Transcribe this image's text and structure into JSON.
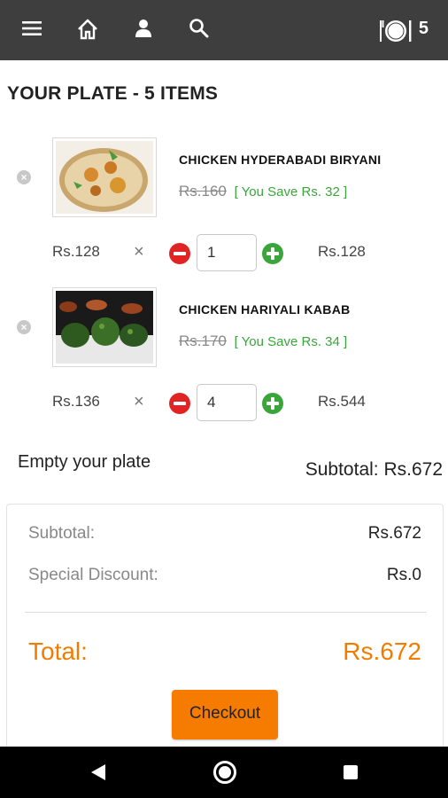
{
  "appbar": {
    "icons": [
      "menu-icon",
      "home-icon",
      "profile-icon",
      "search-icon",
      "plate-icon"
    ],
    "plate_count": "5"
  },
  "page_title": "YOUR PLATE - 5 ITEMS",
  "items": [
    {
      "name": "CHICKEN HYDERABADI BIRYANI",
      "old_price": "Rs.160",
      "savings": "[ You Save Rs. 32 ]",
      "unit_price": "Rs.128",
      "times": "×",
      "quantity": "1",
      "line_total": "Rs.128"
    },
    {
      "name": "CHICKEN HARIYALI KABAB",
      "old_price": "Rs.170",
      "savings": "[ You Save Rs. 34 ]",
      "unit_price": "Rs.136",
      "times": "×",
      "quantity": "4",
      "line_total": "Rs.544"
    }
  ],
  "empty_plate_label": "Empty your plate",
  "subtotal_inline": "Subtotal: Rs.672",
  "summary": {
    "subtotal_label": "Subtotal:",
    "subtotal_value": "Rs.672",
    "discount_label": "Special Discount:",
    "discount_value": "Rs.0",
    "total_label": "Total:",
    "total_value": "Rs.672",
    "checkout_label": "Checkout"
  },
  "colors": {
    "appbar": "#3e3e3e",
    "accent_orange": "#f57c00",
    "total_orange": "#f07d00",
    "savings_green": "#3aa53a",
    "minus_red": "#e02424"
  },
  "navbar": {
    "icons": [
      "back-icon",
      "home-circle-icon",
      "recents-icon"
    ]
  }
}
